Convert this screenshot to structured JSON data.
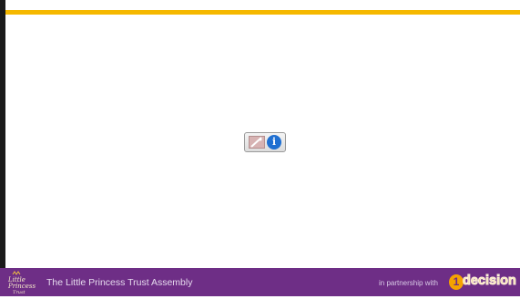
{
  "footer": {
    "title": "The Little Princess Trust Assembly",
    "partner_text": "in partnership with",
    "logo_text": "Little Princess Trust",
    "partner_logo_badge": "1",
    "partner_logo_word": "decision"
  },
  "placeholder": {
    "info_glyph": "i"
  },
  "colors": {
    "accent_bar": "#f5b800",
    "footer_bg": "#6e2e86",
    "info_badge": "#1f6fd1"
  }
}
